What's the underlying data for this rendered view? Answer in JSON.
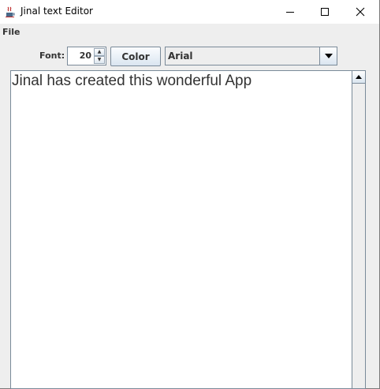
{
  "window": {
    "title": "Jinal text Editor",
    "close_glyph": "✕"
  },
  "menubar": {
    "items": [
      {
        "label": "File"
      }
    ]
  },
  "toolbar": {
    "font_label": "Font:",
    "font_size_value": "20",
    "spin_up_glyph": "▲",
    "spin_down_glyph": "▼",
    "color_button_label": "Color",
    "font_family_selected": "Arial"
  },
  "editor": {
    "content": "Jinal has created this wonderful App"
  },
  "icons": {
    "app": "java-coffee-cup-icon",
    "minimize": "minimize-icon",
    "maximize": "maximize-icon",
    "close": "close-icon"
  }
}
